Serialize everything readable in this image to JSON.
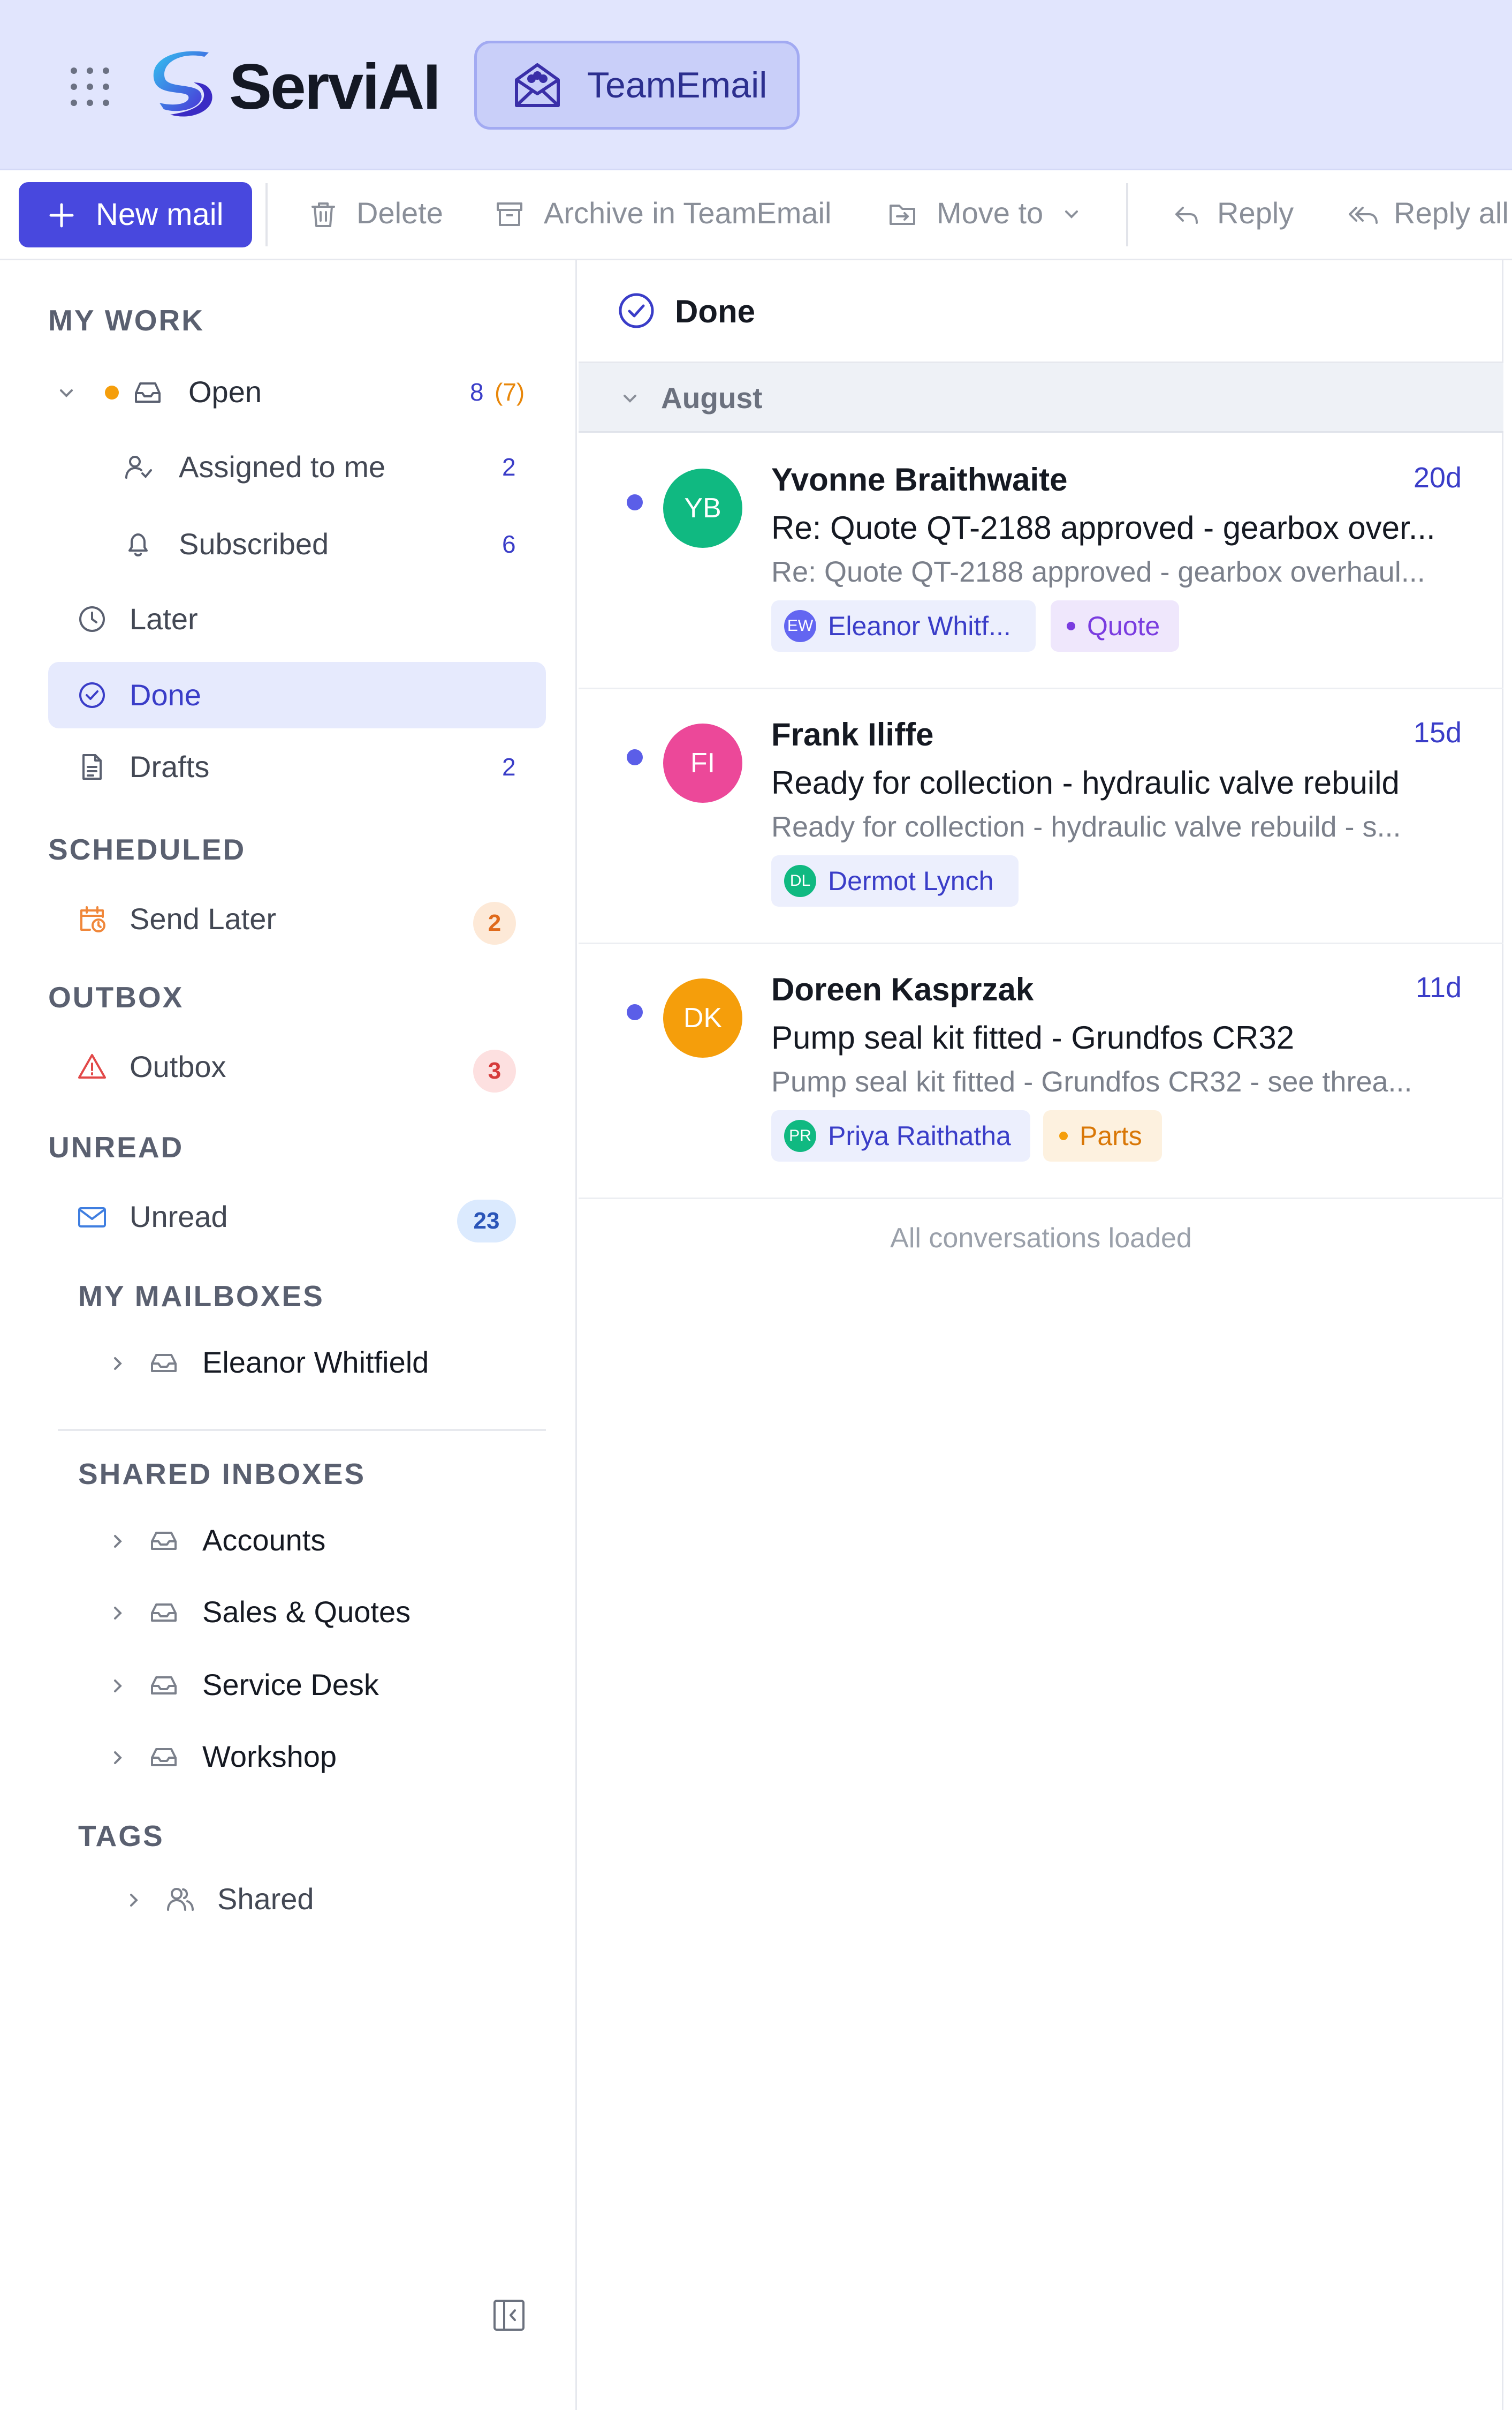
{
  "header": {
    "app_name": "ServiAI",
    "workspace_label": "TeamEmail"
  },
  "toolbar": {
    "new_mail": "New mail",
    "delete": "Delete",
    "archive": "Archive in TeamEmail",
    "move_to": "Move to",
    "reply": "Reply",
    "reply_all": "Reply all"
  },
  "sidebar": {
    "my_work_heading": "MY WORK",
    "open": {
      "label": "Open",
      "count": "8",
      "count_secondary": "(7)"
    },
    "assigned": {
      "label": "Assigned to me",
      "count": "2"
    },
    "subscribed": {
      "label": "Subscribed",
      "count": "6"
    },
    "later": {
      "label": "Later"
    },
    "done": {
      "label": "Done"
    },
    "drafts": {
      "label": "Drafts",
      "count": "2"
    },
    "scheduled_heading": "SCHEDULED",
    "send_later": {
      "label": "Send Later",
      "count": "2"
    },
    "outbox_heading": "OUTBOX",
    "outbox": {
      "label": "Outbox",
      "count": "3"
    },
    "unread_heading": "UNREAD",
    "unread": {
      "label": "Unread",
      "count": "23"
    },
    "my_mailboxes_heading": "MY MAILBOXES",
    "my_mailboxes": [
      {
        "label": "Eleanor Whitfield"
      }
    ],
    "shared_inboxes_heading": "SHARED INBOXES",
    "shared_inboxes": [
      {
        "label": "Accounts"
      },
      {
        "label": "Sales & Quotes"
      },
      {
        "label": "Service Desk"
      },
      {
        "label": "Workshop"
      }
    ],
    "tags_heading": "TAGS",
    "tags": [
      {
        "label": "Shared"
      }
    ]
  },
  "list": {
    "title": "Done",
    "group_label": "August",
    "footer": "All conversations loaded",
    "rows": [
      {
        "initials": "YB",
        "avatar_color": "#10b981",
        "sender": "Yvonne Braithwaite",
        "age": "20d",
        "subject": "Re: Quote QT-2188 approved - gearbox over...",
        "preview": "Re: Quote QT-2188 approved - gearbox overhaul...",
        "assignee": {
          "initials": "EW",
          "name": "Eleanor Whitf...",
          "color": "#6366f1"
        },
        "tag": {
          "name": "Quote",
          "bg": "#efe7fc",
          "fg": "#7a3ce0",
          "dot": "#7a3ce0"
        }
      },
      {
        "initials": "FI",
        "avatar_color": "#ec4899",
        "sender": "Frank Iliffe",
        "age": "15d",
        "subject": "Ready for collection - hydraulic valve rebuild",
        "preview": "Ready for collection - hydraulic valve rebuild - s...",
        "assignee": {
          "initials": "DL",
          "name": "Dermot Lynch",
          "color": "#10b981"
        }
      },
      {
        "initials": "DK",
        "avatar_color": "#f59e0b",
        "sender": "Doreen Kasprzak",
        "age": "11d",
        "subject": "Pump seal kit fitted - Grundfos CR32",
        "preview": "Pump seal kit fitted - Grundfos CR32 - see threa...",
        "assignee": {
          "initials": "PR",
          "name": "Priya Raithatha",
          "color": "#10b981"
        },
        "tag": {
          "name": "Parts",
          "bg": "#fdf1df",
          "fg": "#d97706",
          "dot": "#f59e0b"
        }
      }
    ]
  },
  "colors": {
    "accent": "#4848de",
    "header_bg": "#e1e5fd",
    "unread_dot": "#5b5ee8",
    "open_dot": "#f59e0b"
  },
  "icons": [
    "apps-grid-icon",
    "servi-logo",
    "team-mail-icon",
    "plus-icon",
    "trash-icon",
    "archive-icon",
    "move-icon",
    "chevron-down-icon",
    "reply-icon",
    "reply-all-icon",
    "inbox-icon",
    "user-check-icon",
    "bell-icon",
    "clock-icon",
    "check-circle-icon",
    "file-icon",
    "calendar-clock-icon",
    "warning-icon",
    "mail-icon",
    "chevron-right-icon",
    "users-icon",
    "sidebar-collapse-icon"
  ]
}
